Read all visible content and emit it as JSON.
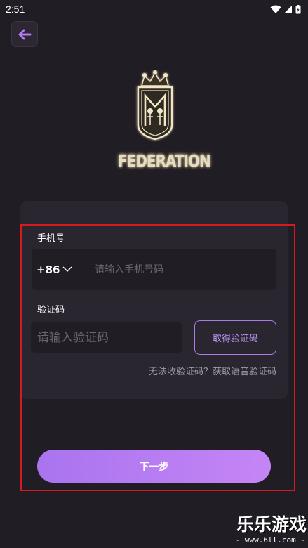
{
  "status_bar": {
    "time": "2:51",
    "icons": [
      "wifi-icon",
      "signal-icon",
      "battery-icon"
    ]
  },
  "header": {
    "back_icon": "arrow-left-icon"
  },
  "brand": {
    "name": "FEDERATION",
    "logo_icon": "crown-shield-logo"
  },
  "form": {
    "phone_label": "手机号",
    "country_code": "+86",
    "phone_placeholder": "请输入手机号码",
    "code_label": "验证码",
    "code_placeholder": "请输入验证码",
    "get_code_label": "取得验证码",
    "help_text": "无法收验证码？获取语音验证码",
    "next_label": "下一步"
  },
  "watermark": {
    "title": "乐乐游戏",
    "url": "- www.6ll.com -"
  },
  "colors": {
    "background": "#211d24",
    "card": "#2a2630",
    "accent": "#b47cf2",
    "highlight_frame": "#d71920"
  }
}
